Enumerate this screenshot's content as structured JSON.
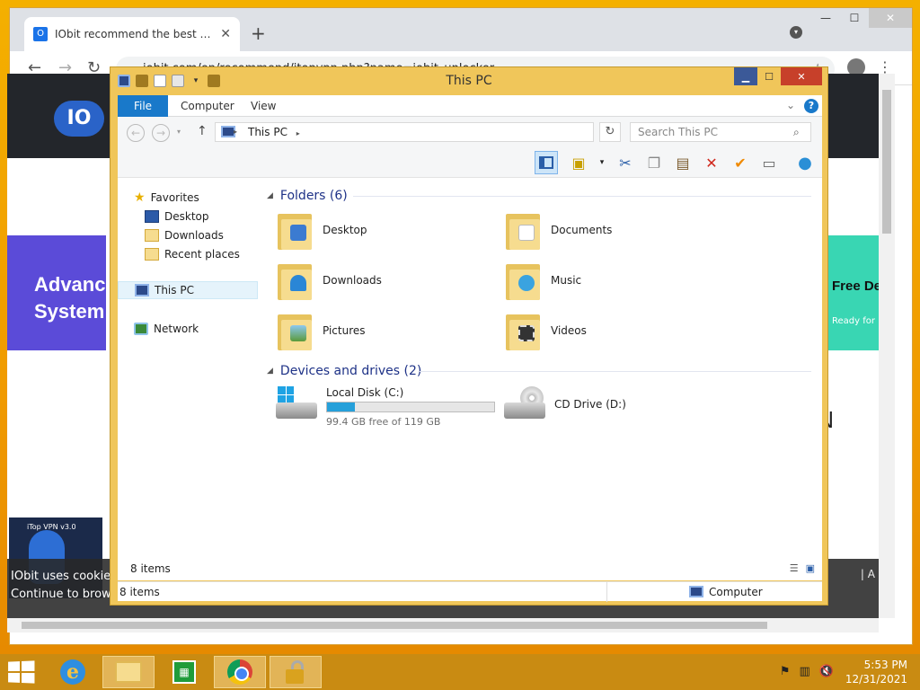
{
  "chrome": {
    "tab_title": "IObit recommend the best free, f",
    "tab_close": "✕",
    "new_tab": "+",
    "url": "iobit.com/en/recommend/itopvpn.php?name=iobit_unlocker"
  },
  "site": {
    "logo_text": "IO",
    "banner_left": "Advanc System",
    "banner_right_title": "Free De",
    "banner_right_sub": "Ready for",
    "right_letter": "N",
    "promo_tag": "iTop VPN v3.0",
    "cookie_line1": "IObit uses cookies",
    "cookie_line2": "Continue to brow",
    "cookie_right": "| A"
  },
  "explorer": {
    "title": "This PC",
    "ribbon_tabs": [
      "File",
      "Computer",
      "View"
    ],
    "address": "This PC",
    "search_placeholder": "Search This PC",
    "nav": {
      "favorites": "Favorites",
      "desktop": "Desktop",
      "downloads": "Downloads",
      "recent": "Recent places",
      "this_pc": "This PC",
      "network": "Network"
    },
    "folders_header": "Folders (6)",
    "folders": [
      "Desktop",
      "Documents",
      "Downloads",
      "Music",
      "Pictures",
      "Videos"
    ],
    "drives_header": "Devices and drives (2)",
    "drives": [
      {
        "name": "Local Disk (C:)",
        "free_text": "99.4 GB free of 119 GB",
        "used_fraction": 0.165
      },
      {
        "name": "CD Drive (D:)"
      }
    ],
    "items_count": "8 items",
    "status_items": "8 items",
    "status_computer": "Computer"
  },
  "taskbar": {
    "time": "5:53 PM",
    "date": "12/31/2021"
  },
  "colors": {
    "accent": "#1979ca",
    "window_frame": "#f0c65a",
    "taskbar": "#c98b12"
  }
}
